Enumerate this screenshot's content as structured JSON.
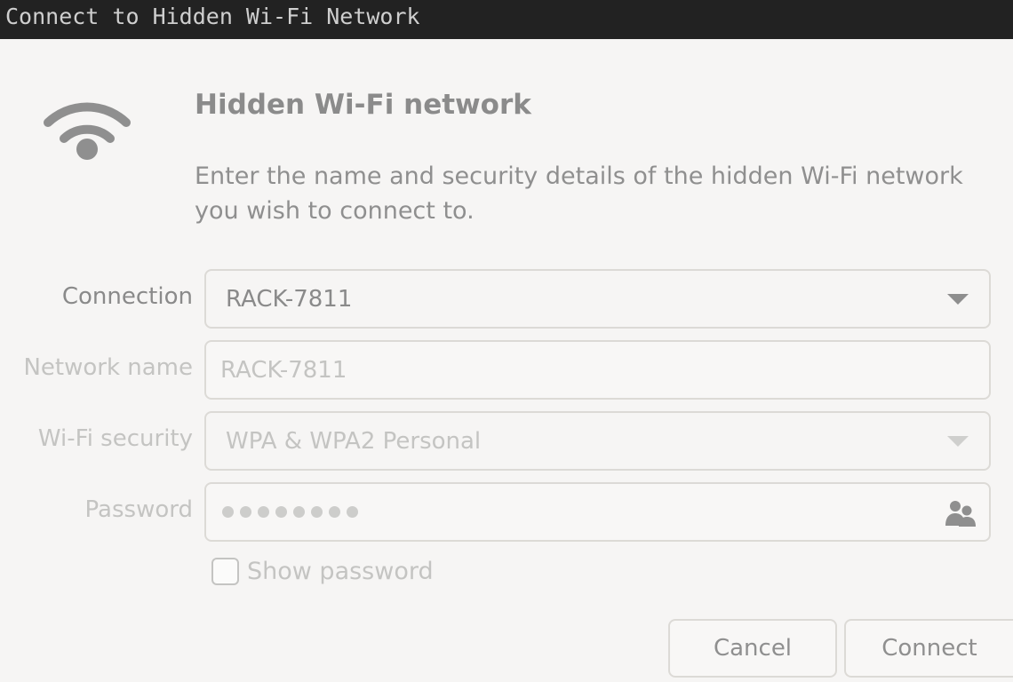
{
  "window": {
    "title": "Connect to Hidden Wi-Fi Network"
  },
  "dialog": {
    "heading": "Hidden Wi-Fi network",
    "description": "Enter the name and security details of the hidden Wi-Fi network you wish to connect to.",
    "icon": "wifi-icon"
  },
  "form": {
    "connection": {
      "label": "Connection",
      "value": "RACK-7811"
    },
    "network_name": {
      "label": "Network name",
      "value": "RACK-7811"
    },
    "wifi_security": {
      "label": "Wi-Fi security",
      "value": "WPA & WPA2 Personal"
    },
    "password": {
      "label": "Password",
      "masked_length": 8,
      "icon": "users-icon"
    },
    "show_password": {
      "label": "Show password",
      "checked": false
    }
  },
  "buttons": {
    "cancel": "Cancel",
    "connect": "Connect"
  },
  "colors": {
    "titlebar": "#222222",
    "background": "#f6f5f4",
    "text": "#8a8a8a",
    "disabled_text": "#c4c4c2",
    "border": "#dcdad6"
  }
}
